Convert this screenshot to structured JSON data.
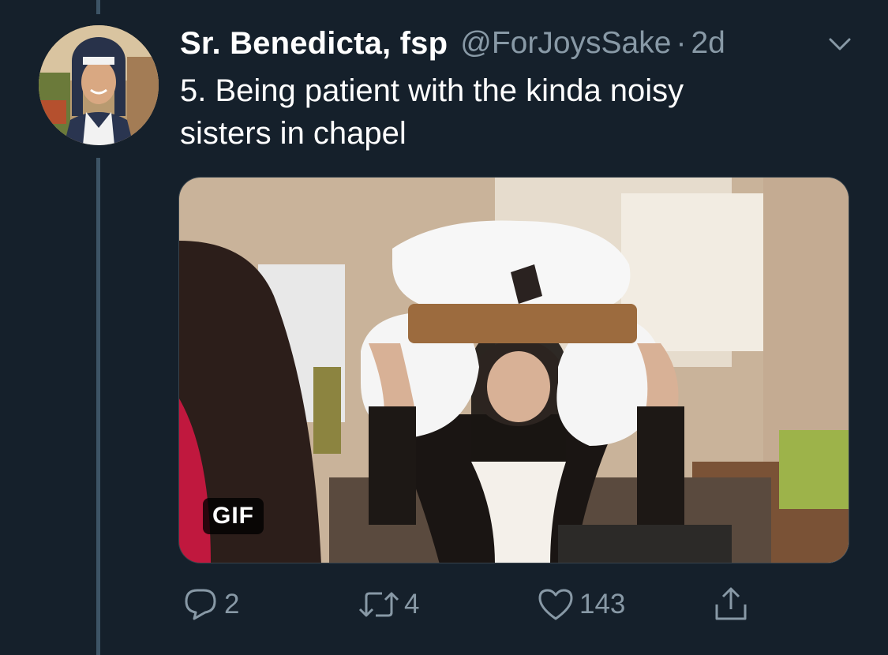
{
  "tweet": {
    "display_name": "Sr. Benedicta, fsp",
    "handle": "@ForJoysSake",
    "separator": "·",
    "time": "2d",
    "text_lines": [
      "5. Being patient with the kinda noisy",
      "sisters in chapel"
    ]
  },
  "media": {
    "badge": "GIF"
  },
  "actions": {
    "reply_count": "2",
    "retweet_count": "4",
    "like_count": "143"
  },
  "icons": {
    "caret": "chevron-down-icon",
    "reply": "reply-icon",
    "retweet": "retweet-icon",
    "like": "heart-icon",
    "share": "share-icon"
  },
  "colors": {
    "background": "#15202b",
    "secondary_text": "#8899a6",
    "thread_line": "#3d5466"
  }
}
